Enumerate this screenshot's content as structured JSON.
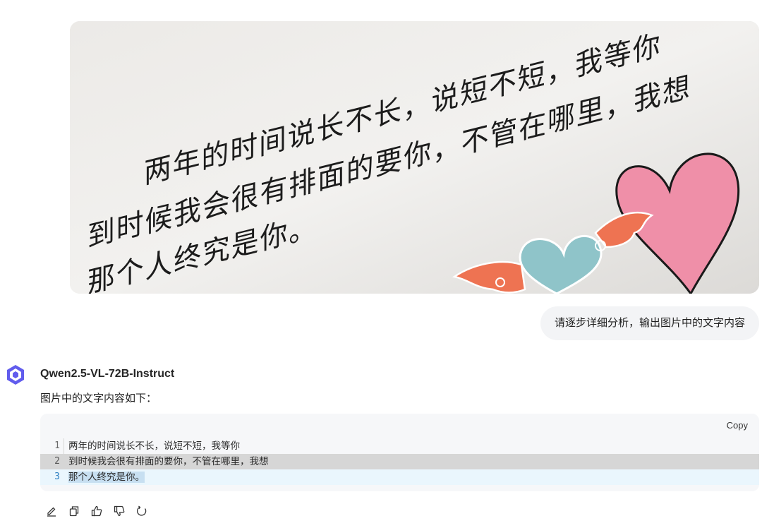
{
  "conversation": {
    "user_prompt": "请逐步详细分析，输出图片中的文字内容",
    "assistant": {
      "model_name": "Qwen2.5-VL-72B-Instruct",
      "intro": "图片中的文字内容如下：",
      "code_block": {
        "copy_label": "Copy",
        "lines": [
          {
            "number": "1",
            "text": "两年的时间说长不长，说短不短，我等你"
          },
          {
            "number": "2",
            "text": "到时候我会很有排面的要你，不管在哪里，我想"
          },
          {
            "number": "3",
            "text": "那个人终究是你。"
          }
        ]
      },
      "actions": [
        "edit-icon",
        "copy-icon",
        "thumbs-up-icon",
        "thumbs-down-icon",
        "regenerate-icon"
      ]
    }
  },
  "image": {
    "handwriting": [
      "两年的时间说长不长，说短不短，我等你",
      "到时候我会很有排面的要你，不管在哪里，我想",
      "那个人终究是你。"
    ]
  },
  "colors": {
    "bubble_bg": "#f3f4f6",
    "code_bg": "#f6f7f9",
    "selection": "#d6d6d6",
    "active_line": "#eaf6fd",
    "heart_pink": "#ef8fa8",
    "heart_blue": "#8fc4c9",
    "wing_orange": "#ee7352"
  }
}
